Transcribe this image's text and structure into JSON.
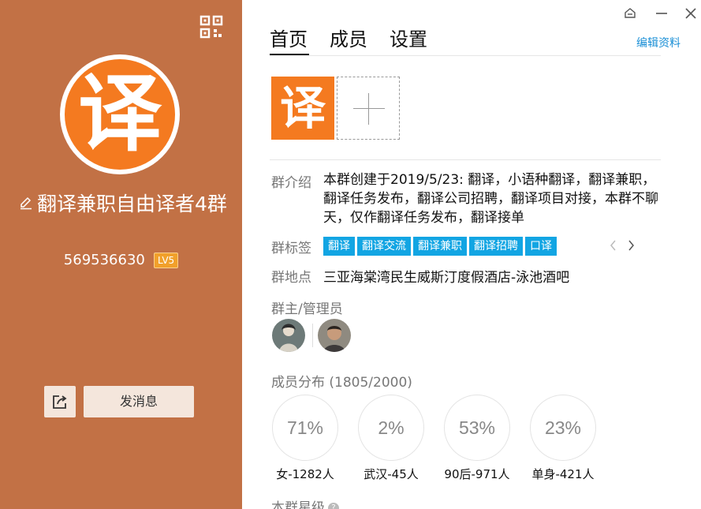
{
  "colors": {
    "left_panel": "#c27145",
    "brand_orange": "#f47a20",
    "tag_blue": "#12a5e3",
    "link_blue": "#1a8fd6",
    "badge": "#f1a02b"
  },
  "profile": {
    "avatar_char": "译",
    "name": "翻译兼职自由译者4群",
    "group_id": "569536630",
    "level_badge": "LV5",
    "icons": {
      "qr": "qr-code-icon",
      "edit": "pencil-icon",
      "share": "share-icon"
    }
  },
  "actions": {
    "send_message": "发消息"
  },
  "window_controls": [
    "skin-icon",
    "minimize-icon",
    "close-icon"
  ],
  "tabs": [
    {
      "label": "首页",
      "active": true
    },
    {
      "label": "成员",
      "active": false
    },
    {
      "label": "设置",
      "active": false
    }
  ],
  "edit_profile": "编辑资料",
  "photos": {
    "logo_char": "译"
  },
  "intro": {
    "label": "群介绍",
    "text": "本群创建于2019/5/23: 翻译，小语种翻译，翻译兼职，翻译任务发布，翻译公司招聘，翻译项目对接，本群不聊天，仅作翻译任务发布，翻译接单"
  },
  "tags": {
    "label": "群标签",
    "items": [
      "翻译",
      "翻译交流",
      "翻译兼职",
      "翻译招聘",
      "口译"
    ]
  },
  "location": {
    "label": "群地点",
    "value": "三亚海棠湾民生威斯汀度假酒店-泳池酒吧"
  },
  "admins": {
    "label": "群主/管理员"
  },
  "distribution": {
    "label": "成员分布 (1805/2000)",
    "stats": [
      {
        "percent": "71%",
        "label": "女-1282人"
      },
      {
        "percent": "2%",
        "label": "武汉-45人"
      },
      {
        "percent": "53%",
        "label": "90后-971人"
      },
      {
        "percent": "23%",
        "label": "单身-421人"
      }
    ]
  },
  "group_level": {
    "label": "本群星级",
    "help": "?"
  }
}
